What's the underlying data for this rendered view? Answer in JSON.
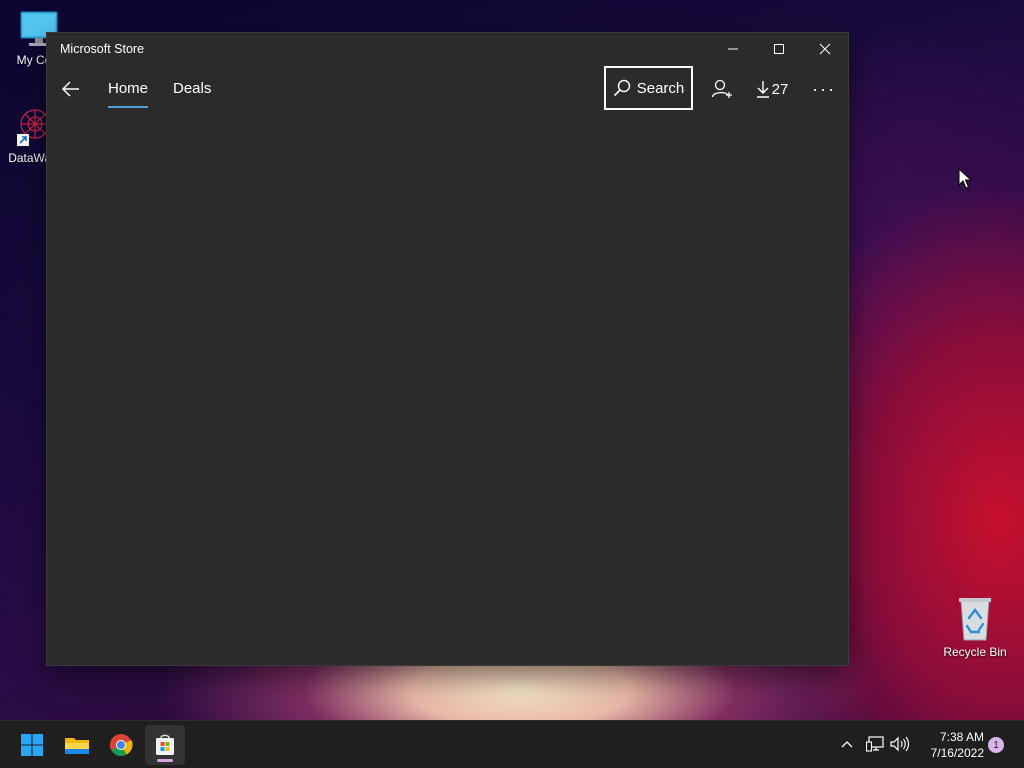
{
  "desktop": {
    "icons": [
      {
        "label": "My Computer",
        "shown": "My Com"
      },
      {
        "label": "DataWagon",
        "shown": "DataWag"
      },
      {
        "label": "Recycle Bin",
        "shown": "Recycle Bin"
      }
    ]
  },
  "window": {
    "title": "Microsoft Store",
    "nav": {
      "tabs": [
        {
          "label": "Home",
          "selected": true
        },
        {
          "label": "Deals",
          "selected": false
        }
      ],
      "search_label": "Search",
      "downloads_count": "27",
      "more_label": "···"
    }
  },
  "taskbar": {
    "apps": [
      "start-icon",
      "file-explorer-icon",
      "chrome-icon",
      "microsoft-store-icon"
    ],
    "clock": {
      "time": "7:38 AM",
      "date": "7/16/2022"
    },
    "notification_count": "1"
  },
  "colors": {
    "accent": "#4ca0e0",
    "window_bg": "#2b2b2b",
    "taskbar_bg": "#1f1f1f"
  }
}
